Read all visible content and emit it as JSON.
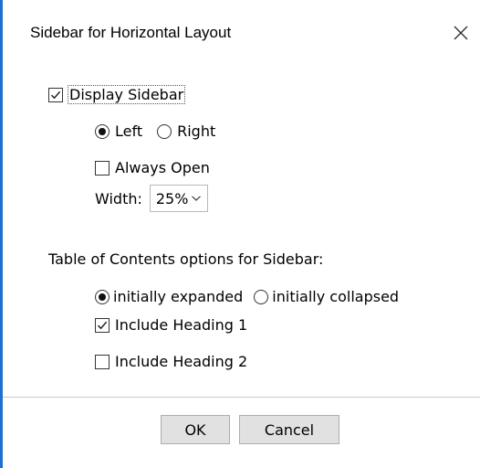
{
  "dialog": {
    "title": "Sidebar for Horizontal Layout"
  },
  "options": {
    "display_sidebar": {
      "label": "Display Sidebar",
      "checked": true
    },
    "position": {
      "left_label": "Left",
      "right_label": "Right",
      "selected": "Left"
    },
    "always_open": {
      "label": "Always Open",
      "checked": false
    },
    "width": {
      "label": "Width:",
      "value": "25%"
    }
  },
  "toc": {
    "heading": "Table of Contents options for Sidebar:",
    "expanded_label": "initially expanded",
    "collapsed_label": "initially collapsed",
    "selected": "initially expanded",
    "heading1": {
      "label": "Include Heading 1",
      "checked": true
    },
    "heading2": {
      "label": "Include Heading 2",
      "checked": false
    }
  },
  "buttons": {
    "ok_label": "OK",
    "cancel_label": "Cancel"
  },
  "icons": {
    "close": "close-icon",
    "checkmark": "checkmark-icon",
    "dropdown": "chevron-down-icon"
  },
  "colors": {
    "window_border": "#1f6fd1",
    "button_face": "#e1e1e1",
    "button_border": "#adadad"
  }
}
